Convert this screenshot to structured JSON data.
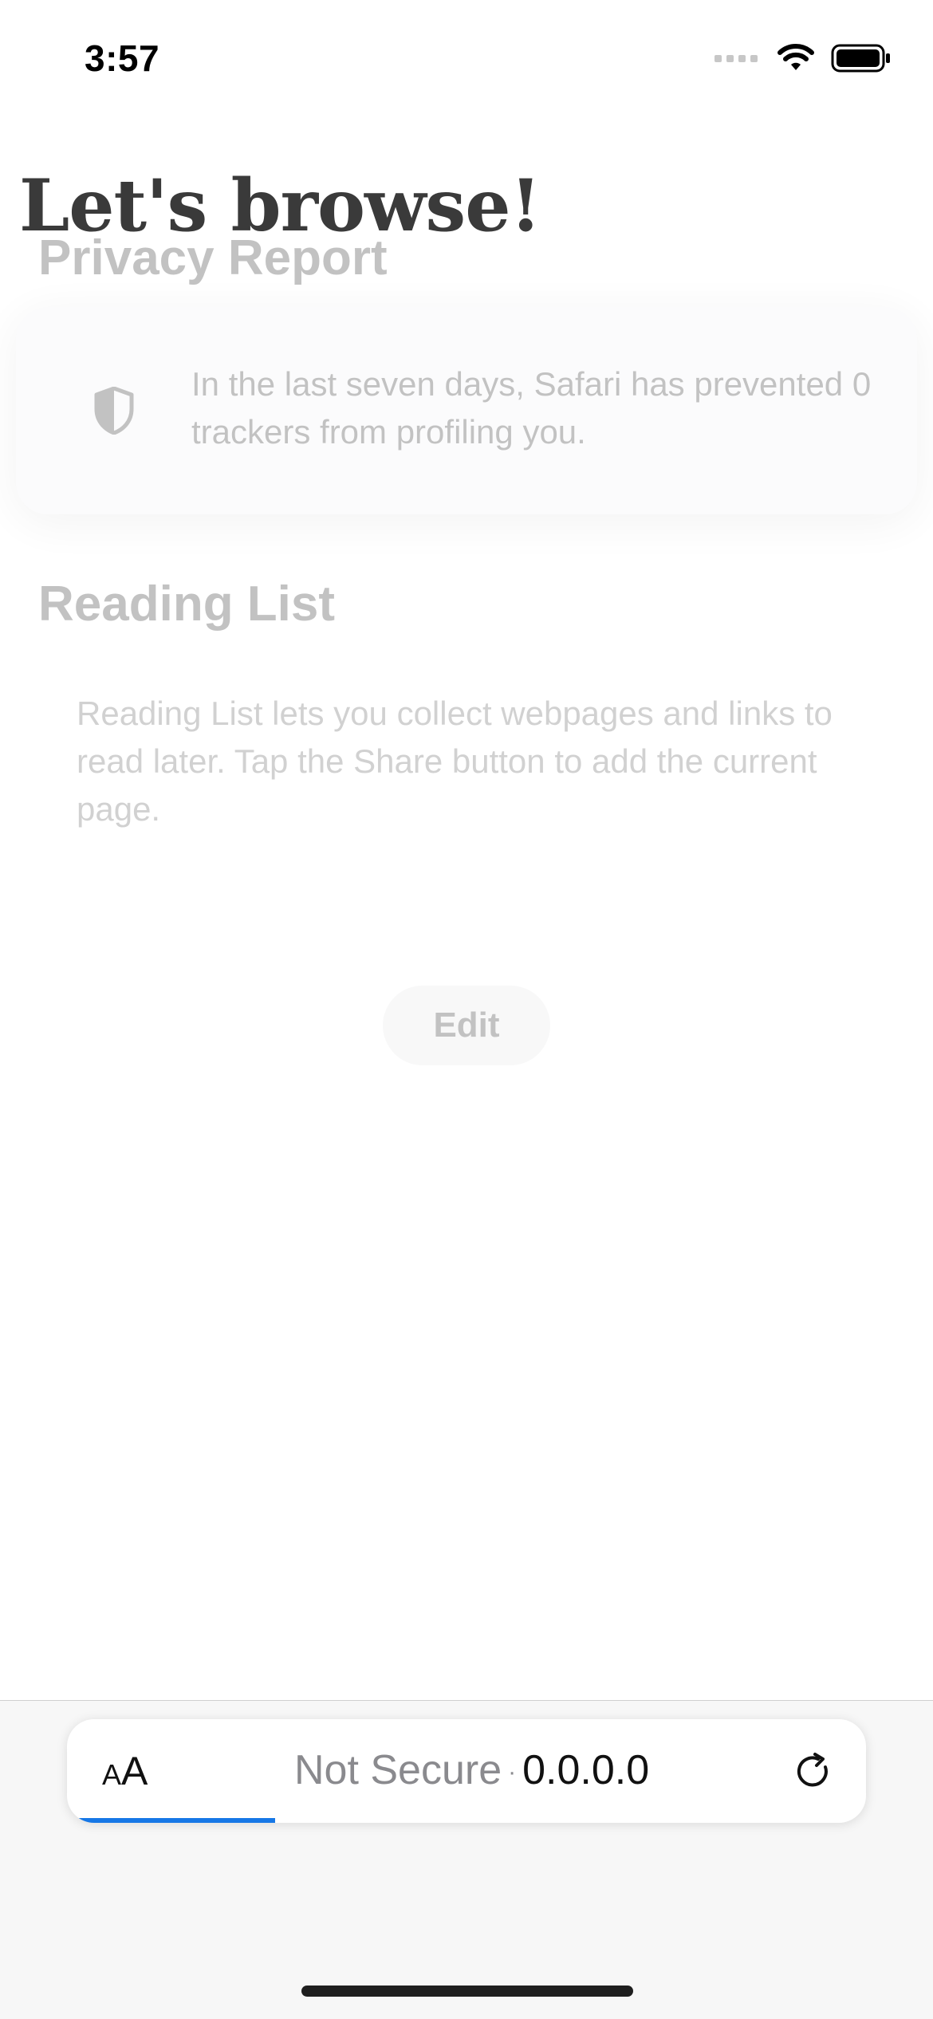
{
  "status_bar": {
    "time": "3:57"
  },
  "web_page": {
    "heading": "Let's browse!"
  },
  "start_page": {
    "privacy_report": {
      "title": "Privacy Report",
      "text": "In the last seven days, Safari has prevented 0 trackers from profiling you."
    },
    "reading_list": {
      "title": "Reading List",
      "text": "Reading List lets you collect webpages and links to read later. Tap the Share button to add the current page."
    },
    "edit_label": "Edit"
  },
  "address_bar": {
    "text_size_small": "A",
    "text_size_large": "A",
    "security": "Not Secure",
    "separator": "·",
    "url": "0.0.0.0",
    "load_progress": 0.26
  },
  "toolbar": {
    "icons": [
      "back-icon",
      "forward-icon",
      "share-icon",
      "bookmarks-icon",
      "tabs-icon"
    ]
  },
  "colors": {
    "accent": "#1677e6",
    "toolbar_bg": "#f7f7f7",
    "heading": "#3a3a3a"
  }
}
